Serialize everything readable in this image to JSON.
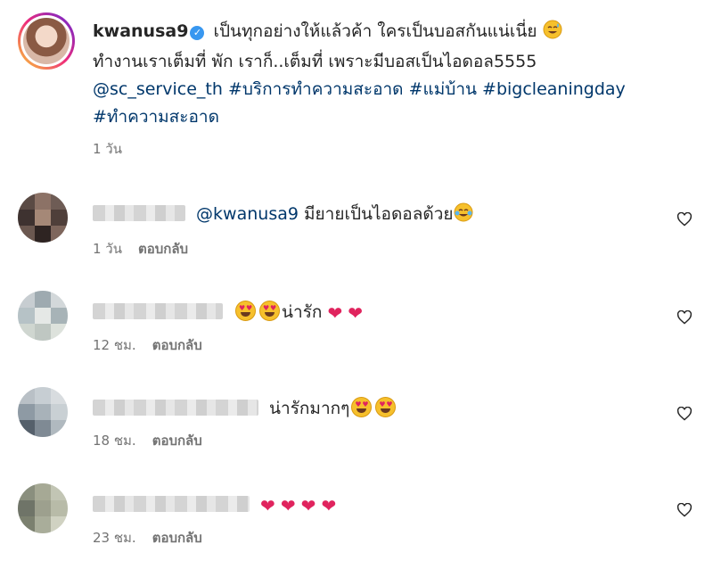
{
  "post": {
    "username": "kwanusa9",
    "caption_line1": "เป็นทุกอย่างให้แล้วค้า ใครเป็นบอสกันแน่เนี่ย",
    "caption_line2": "ทำงานเราเต็มที่ พัก เราก็..เต็มที่ เพราะมีบอสเป็นไอดอล5555",
    "mention": "@sc_service_th",
    "hashtags": [
      "#บริการทำความสะอาด",
      "#แม่บ้าน",
      "#bigcleaningday",
      "#ทำความสะอาด"
    ],
    "time": "1 วัน"
  },
  "comments": [
    {
      "text_prefix": "@kwanusa9",
      "text": "มียายเป็นไอดอลด้วย",
      "time": "1 วัน",
      "reply": "ตอบกลับ",
      "avatar_colors": [
        "#5a4a44",
        "#8c7266",
        "#6e5c55",
        "#3e3230",
        "#a58877",
        "#4f3f3a",
        "#6b5850",
        "#2e2422",
        "#7e665c"
      ]
    },
    {
      "text": "น่ารัก",
      "time": "12 ชม.",
      "reply": "ตอบกลับ",
      "avatar_colors": [
        "#c7cdd1",
        "#9eaab0",
        "#d3d8da",
        "#b6c2c6",
        "#e5e8e6",
        "#a7b3b7",
        "#cfd6d0",
        "#bfc7c2",
        "#dde2dc"
      ]
    },
    {
      "text": "น่ารักมากๆ",
      "time": "18 ชม.",
      "reply": "ตอบกลับ",
      "avatar_colors": [
        "#b9c0c6",
        "#c7ced3",
        "#d8dcdf",
        "#8e9aa4",
        "#a8b2b9",
        "#c9d0d4",
        "#55606b",
        "#7f8a94",
        "#b0b9bf"
      ]
    },
    {
      "text": "",
      "time": "23 ชม.",
      "reply": "ตอบกลับ",
      "avatar_colors": [
        "#8a8f7e",
        "#a6a995",
        "#c2c5b4",
        "#6f7468",
        "#9da08e",
        "#b8bba8",
        "#7b806f",
        "#a9ad9a",
        "#d0d2c2"
      ]
    }
  ],
  "colors": {
    "link": "#00376b",
    "muted": "#737373",
    "heart": "#e0245e",
    "verified": "#3897f0"
  },
  "icons": {
    "like": "heart-outline-icon",
    "verified": "verified-badge-icon"
  }
}
